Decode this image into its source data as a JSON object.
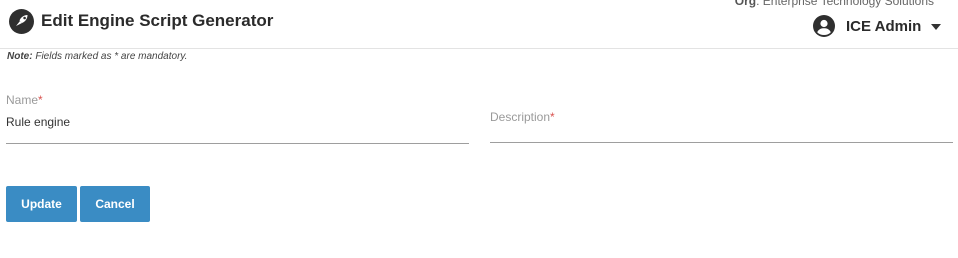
{
  "header": {
    "title": "Edit Engine Script Generator",
    "logo_icon": "rocket-logo-icon",
    "org_label": "Org",
    "org_name": ": Enterprise Technology Solutions",
    "user_name": "ICE Admin",
    "user_icon": "account-circle-icon",
    "menu_icon": "caret-down-icon"
  },
  "note": {
    "label": "Note:",
    "text": " Fields marked as * are mandatory."
  },
  "form": {
    "name_label": "Name",
    "name_value": "Rule engine",
    "description_label": "Description",
    "description_value": "",
    "required_marker": "*"
  },
  "actions": {
    "update_label": "Update",
    "cancel_label": "Cancel"
  },
  "colors": {
    "primary_button": "#3a8cc4",
    "required": "#d9534f"
  }
}
